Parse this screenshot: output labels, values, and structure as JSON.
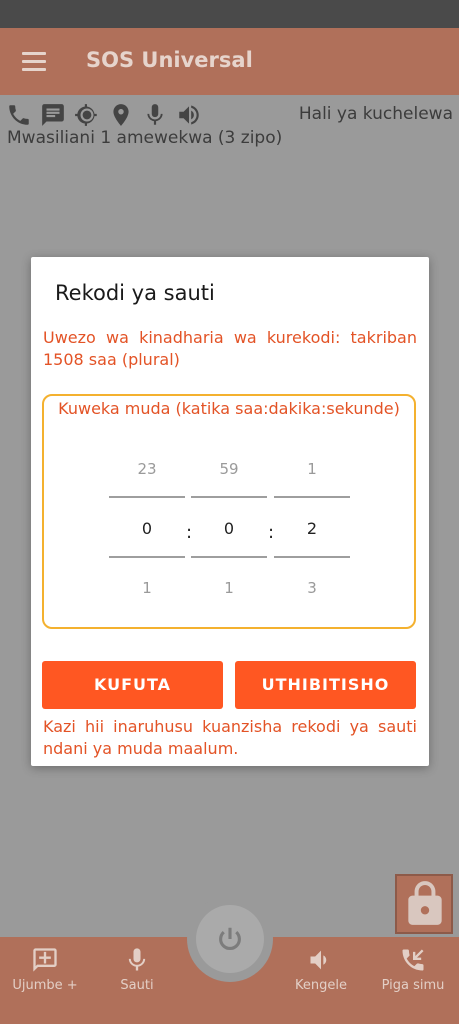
{
  "app": {
    "title": "SOS Universal"
  },
  "status": {
    "delay_label": "Hali ya kuchelewa",
    "contacts_text": "Mwasiliani 1 amewekwa (3 zipo)"
  },
  "toolbar_icons": [
    "phone-icon",
    "message-icon",
    "location-target-icon",
    "map-pin-icon",
    "microphone-icon",
    "speaker-icon"
  ],
  "dialog": {
    "title": "Rekodi ya sauti",
    "capacity_text": "Uwezo wa kinadharia wa kurekodi: takriban 1508 saa (plural)",
    "picker_label": "Kuweka muda (katika saa:dakika:sekunde)",
    "hours": {
      "prev": "23",
      "current": "0",
      "next": "1"
    },
    "minutes": {
      "prev": "59",
      "current": "0",
      "next": "1"
    },
    "seconds": {
      "prev": "1",
      "current": "2",
      "next": "3"
    },
    "separator": ":",
    "cancel_label": "KUFUTA",
    "confirm_label": "UTHIBITISHO",
    "info_text": "Kazi hii inaruhusu kuanzisha rekodi ya sauti ndani ya muda maalum."
  },
  "bottom_nav": {
    "messages_plus": "Ujumbe +",
    "audio": "Sauti",
    "bell": "Kengele",
    "call": "Piga simu"
  },
  "colors": {
    "accent": "#ff5722",
    "picker_border": "#f4b12f",
    "appbar": "#b0705a"
  }
}
